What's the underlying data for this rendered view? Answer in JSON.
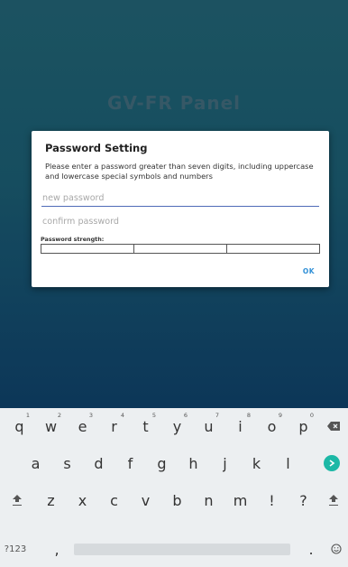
{
  "app": {
    "title": "GV-FR Panel"
  },
  "dialog": {
    "title": "Password Setting",
    "message": "Please enter a password greater than seven digits, including uppercase and lowercase special symbols and numbers",
    "new_password_placeholder": "new password",
    "confirm_password_placeholder": "confirm password",
    "strength_label": "Password strength:",
    "ok_label": "OK"
  },
  "keyboard": {
    "row1": [
      {
        "label": "q",
        "hint": "1"
      },
      {
        "label": "w",
        "hint": "2"
      },
      {
        "label": "e",
        "hint": "3"
      },
      {
        "label": "r",
        "hint": "4"
      },
      {
        "label": "t",
        "hint": "5"
      },
      {
        "label": "y",
        "hint": "6"
      },
      {
        "label": "u",
        "hint": "7"
      },
      {
        "label": "i",
        "hint": "8"
      },
      {
        "label": "o",
        "hint": "9"
      },
      {
        "label": "p",
        "hint": "0"
      }
    ],
    "row2": [
      "a",
      "s",
      "d",
      "f",
      "g",
      "h",
      "j",
      "k",
      "l"
    ],
    "row3": [
      "z",
      "x",
      "c",
      "v",
      "b",
      "n",
      "m",
      "!",
      "?"
    ],
    "symbols_key": "?123",
    "comma_key": ",",
    "period_key": ".",
    "colors": {
      "accent": "#1cb8a6"
    }
  }
}
